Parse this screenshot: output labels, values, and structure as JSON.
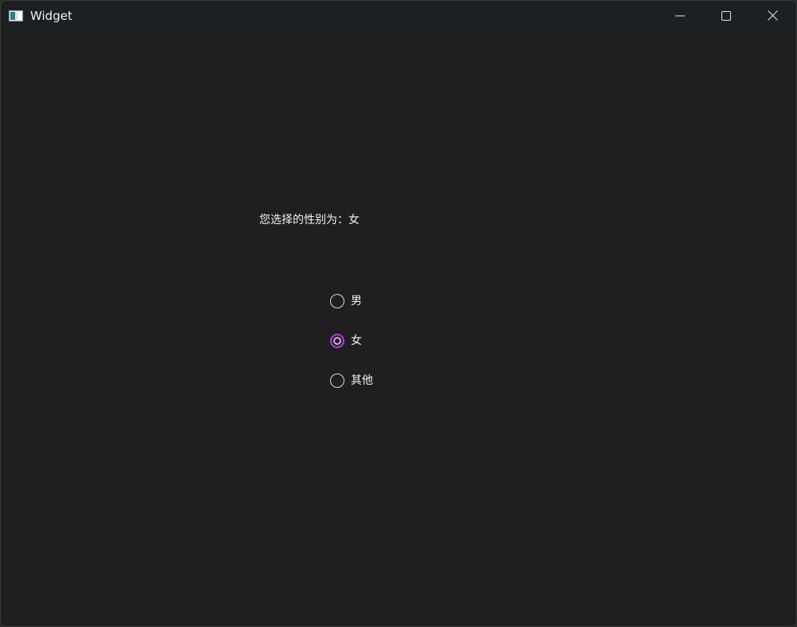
{
  "window": {
    "title": "Widget",
    "icon": "app-window-icon",
    "controls": {
      "minimize": "minimize-icon",
      "maximize": "maximize-icon",
      "close": "close-icon"
    }
  },
  "main": {
    "status_text": "您选择的性别为：女",
    "options": [
      {
        "label": "男",
        "checked": false
      },
      {
        "label": "女",
        "checked": true
      },
      {
        "label": "其他",
        "checked": false
      }
    ]
  },
  "colors": {
    "background": "#1f1f1f",
    "titlebar": "#1c2023",
    "accent": "#b43fd6",
    "text": "#f2f2f2"
  }
}
